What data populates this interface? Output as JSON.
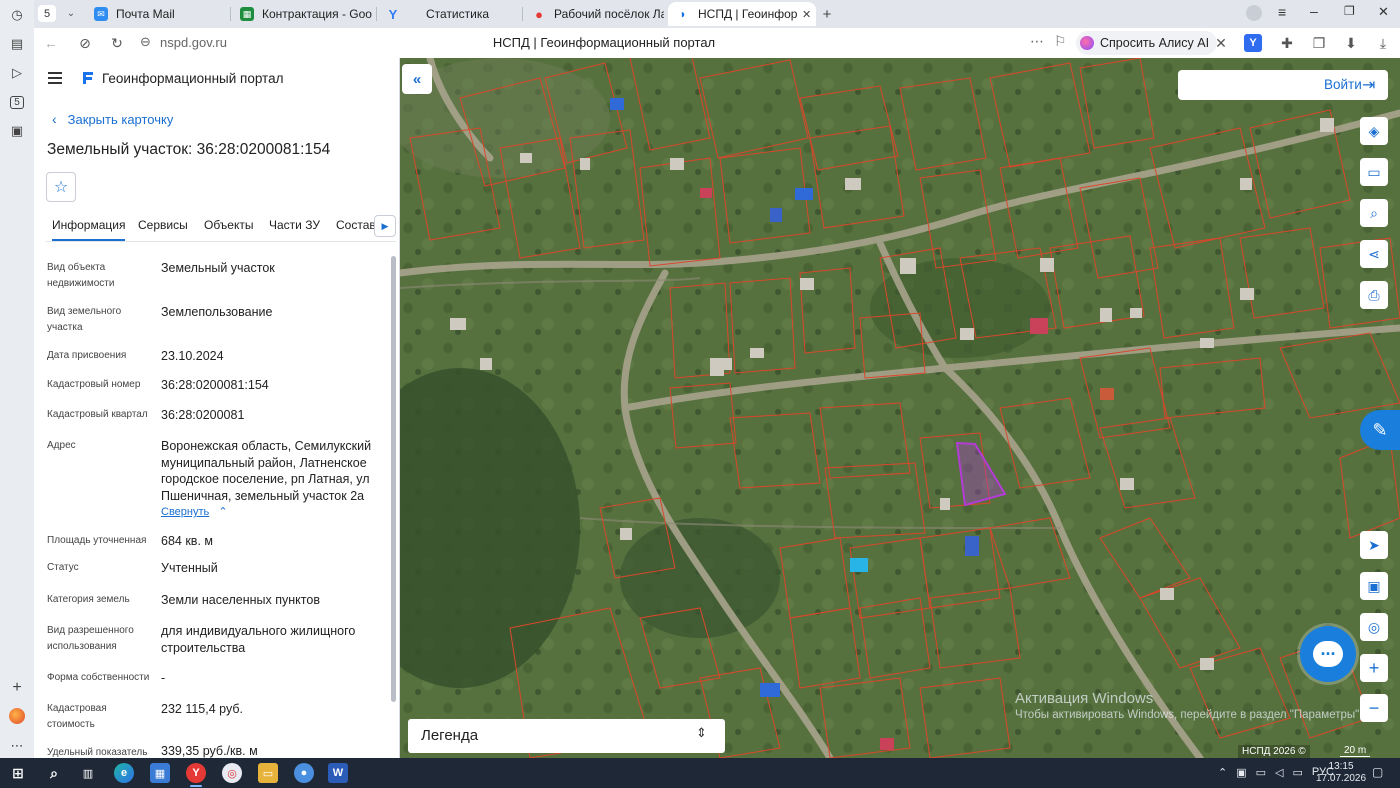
{
  "browser": {
    "tab_counter": "5",
    "tabs": [
      {
        "label": "Почта Mail",
        "icon": "mail-icon",
        "color": "#2f8cf0"
      },
      {
        "label": "Контрактация - Google Та",
        "icon": "sheets-icon",
        "color": "#1e8e3e"
      },
      {
        "label": "Статистика",
        "icon": "yandex-y-icon",
        "color": "#2f7cf6"
      },
      {
        "label": "Рабочий посёлок Латная",
        "icon": "map-pin-icon",
        "color": "#e53935"
      },
      {
        "label": "НСПД | Геоинформаци",
        "icon": "nspd-icon",
        "color": "#1a73e8"
      }
    ],
    "url_host": "nspd.gov.ru",
    "page_title": "НСПД | Геоинформационный портал",
    "alice_label": "Спросить Алису AI"
  },
  "panel": {
    "portal_title": "Геоинформационный портал",
    "close_card": "Закрыть карточку",
    "card_title": "Земельный участок: 36:28:0200081:154",
    "tabs": [
      "Информация",
      "Сервисы",
      "Объекты",
      "Части ЗУ",
      "Состав"
    ],
    "fields": [
      {
        "label": "Вид объекта недвижимости",
        "value": "Земельный участок"
      },
      {
        "label": "Вид земельного участка",
        "value": "Землепользование"
      },
      {
        "label": "Дата присвоения",
        "value": "23.10.2024"
      },
      {
        "label": "Кадастровый номер",
        "value": "36:28:0200081:154"
      },
      {
        "label": "Кадастровый квартал",
        "value": "36:28:0200081"
      },
      {
        "label": "Адрес",
        "value": "Воронежская область, Семилукский муниципальный район, Латненское городское поселение, рп Латная, ул Пшеничная, земельный участок 2а"
      },
      {
        "label": "Площадь уточненная",
        "value": "684 кв. м"
      },
      {
        "label": "Статус",
        "value": "Учтенный"
      },
      {
        "label": "Категория земель",
        "value": "Земли населенных пунктов"
      },
      {
        "label": "Вид разрешенного использования",
        "value": "для индивидуального жилищного строительства"
      },
      {
        "label": "Форма собственности",
        "value": "-"
      },
      {
        "label": "Кадастровая стоимость",
        "value": "232 115,4 руб."
      },
      {
        "label": "Удельный показатель",
        "value": "339,35 руб./кв. м"
      }
    ],
    "collapse_link": "Свернуть"
  },
  "map": {
    "login_label": "Войти",
    "legend_label": "Легенда",
    "watermark_title": "Активация Windows",
    "watermark_sub": "Чтобы активировать Windows, перейдите в раздел \"Параметры\".",
    "copyright": "НСПД 2026 ©",
    "scale": "20 m",
    "parcel_outline_color": "#d9482b",
    "selected_parcel_color": "#b43cd6",
    "tools": [
      "layers-icon",
      "ruler-icon",
      "scan-search-icon",
      "share-icon",
      "print-icon",
      "navigate-icon",
      "basemap-icon",
      "location-icon",
      "zoom-in-icon",
      "zoom-out-icon"
    ]
  },
  "taskbar": {
    "lang": "РУС",
    "time": "13:15",
    "date": "17.07.2026"
  }
}
